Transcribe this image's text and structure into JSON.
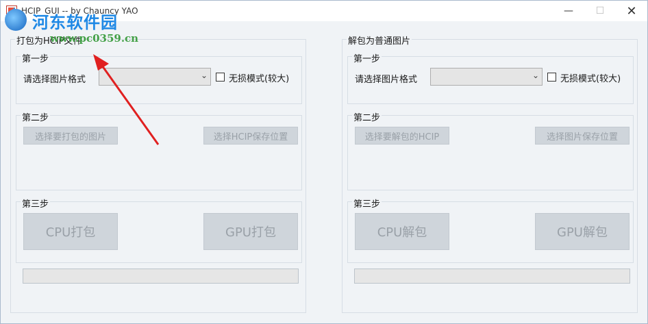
{
  "window": {
    "title": "HCIP_GUI -- by Chauncy YAO",
    "minimize_label": "—",
    "maximize_label": "☐",
    "close_label": "✕"
  },
  "watermark": {
    "name": "河东软件园",
    "url": "www.pc0359.cn"
  },
  "left_panel": {
    "title": "打包为HCIP文件",
    "step1": {
      "title": "第一步",
      "format_label": "请选择图片格式",
      "format_value": "",
      "lossless_label": "无损模式(较大)"
    },
    "step2": {
      "title": "第二步",
      "select_button": "选择要打包的图片",
      "save_button": "选择HCIP保存位置"
    },
    "step3": {
      "title": "第三步",
      "cpu_button": "CPU打包",
      "gpu_button": "GPU打包"
    }
  },
  "right_panel": {
    "title": "解包为普通图片",
    "step1": {
      "title": "第一步",
      "format_label": "请选择图片格式",
      "format_value": "",
      "lossless_label": "无损模式(较大)"
    },
    "step2": {
      "title": "第二步",
      "select_button": "选择要解包的HCIP",
      "save_button": "选择图片保存位置"
    },
    "step3": {
      "title": "第三步",
      "cpu_button": "CPU解包",
      "gpu_button": "GPU解包"
    }
  },
  "colors": {
    "annotation_arrow": "#e02020",
    "disabled_button_bg": "#cfd5db",
    "disabled_button_text": "#9aa1a8"
  }
}
